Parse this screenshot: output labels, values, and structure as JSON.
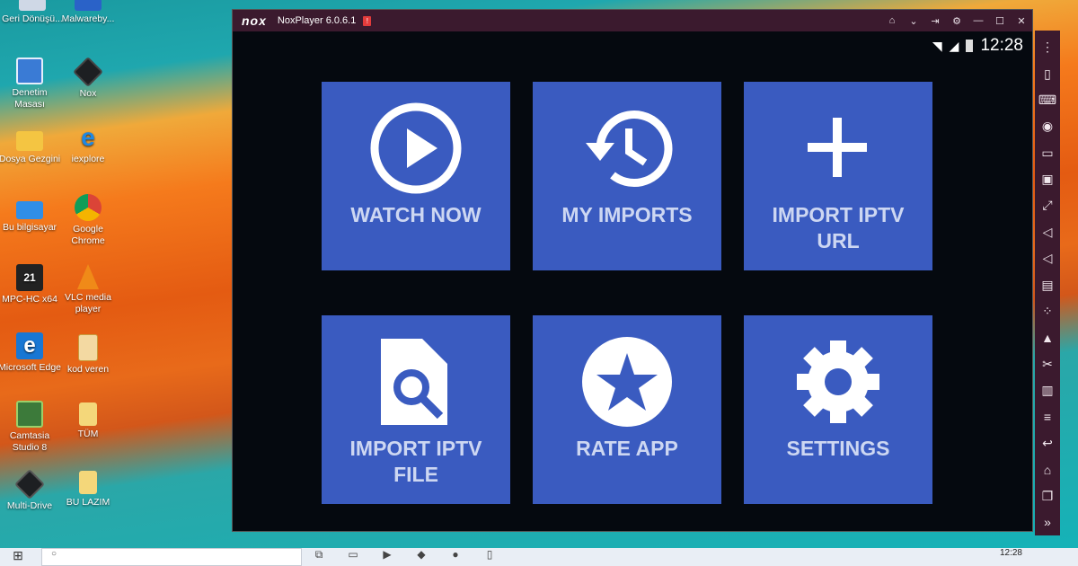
{
  "desktop": {
    "icons": [
      {
        "label": "Geri Dönüşü...",
        "icon": "recycle-bin-icon"
      },
      {
        "label": "Malwareby...",
        "icon": "malwarebytes-icon"
      },
      {
        "label": "Denetim Masası",
        "icon": "control-panel-icon"
      },
      {
        "label": "Nox",
        "icon": "nox-icon"
      },
      {
        "label": "Dosya Gezgini",
        "icon": "folder-icon"
      },
      {
        "label": "iexplore",
        "icon": "internet-explorer-icon"
      },
      {
        "label": "Bu bilgisayar",
        "icon": "computer-icon"
      },
      {
        "label": "Google Chrome",
        "icon": "chrome-icon"
      },
      {
        "label": "MPC-HC x64",
        "icon": "mpc-hc-icon"
      },
      {
        "label": "VLC media player",
        "icon": "vlc-icon"
      },
      {
        "label": "Microsoft Edge",
        "icon": "edge-icon"
      },
      {
        "label": "kod veren",
        "icon": "document-icon"
      },
      {
        "label": "Camtasia Studio 8",
        "icon": "camtasia-icon"
      },
      {
        "label": "TÜM",
        "icon": "folder-icon"
      },
      {
        "label": "Multi-Drive",
        "icon": "nox-multidrive-icon"
      },
      {
        "label": "BU LAZIM",
        "icon": "folder-icon"
      }
    ]
  },
  "nox": {
    "logo": "nox",
    "title": "NoxPlayer 6.0.6.1",
    "badge": "!",
    "controls": [
      "home-icon",
      "chevron-down-icon",
      "pin-icon",
      "gear-icon",
      "minimize-icon",
      "maximize-icon",
      "close-icon"
    ],
    "status": {
      "time": "12:28"
    },
    "tiles": [
      {
        "label": "WATCH NOW",
        "icon": "play-icon"
      },
      {
        "label": "MY IMPORTS",
        "icon": "history-icon"
      },
      {
        "label": "IMPORT IPTV URL",
        "icon": "plus-icon"
      },
      {
        "label": "IMPORT IPTV FILE",
        "icon": "file-search-icon"
      },
      {
        "label": "RATE APP",
        "icon": "star-icon"
      },
      {
        "label": "SETTINGS",
        "icon": "gear-icon"
      }
    ],
    "sidebar": [
      "menu-icon",
      "shake-icon",
      "keyboard-icon",
      "location-icon",
      "screen-icon",
      "apk-icon",
      "fullscreen-icon",
      "volume-up-icon",
      "volume-down-icon",
      "toolbox-icon",
      "macro-icon",
      "screenshot-icon",
      "scissors-icon",
      "multi-instance-icon",
      "more-menu-icon",
      "back-icon",
      "home-icon",
      "recent-apps-icon",
      "expand-icon"
    ]
  },
  "taskbar": {
    "clock": "12:28"
  },
  "colors": {
    "tile": "#3a5bc0",
    "nox_frame": "#3b1a2e"
  }
}
